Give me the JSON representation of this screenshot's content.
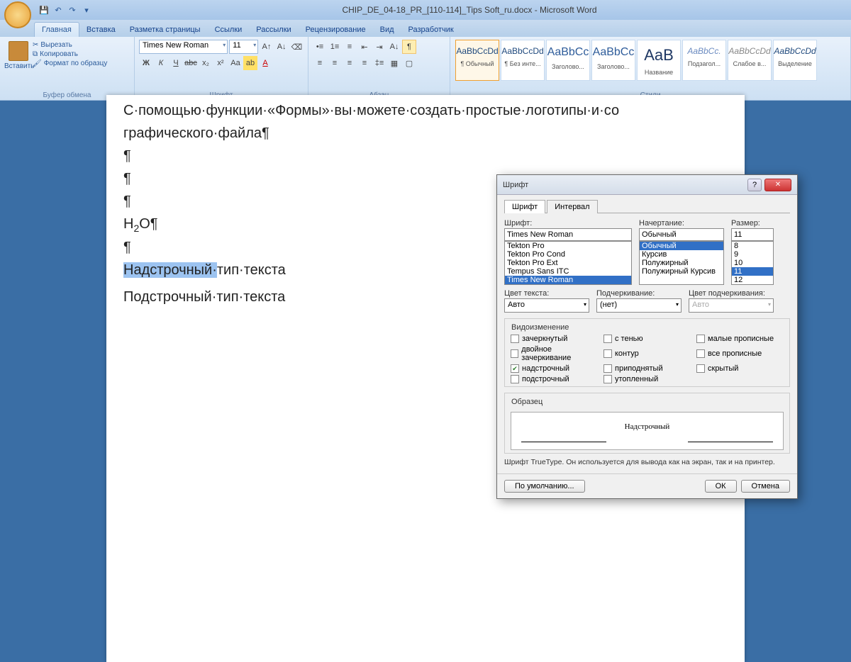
{
  "title": "CHIP_DE_04-18_PR_[110-114]_Tips Soft_ru.docx - Microsoft Word",
  "tabs": [
    "Главная",
    "Вставка",
    "Разметка страницы",
    "Ссылки",
    "Рассылки",
    "Рецензирование",
    "Вид",
    "Разработчик"
  ],
  "clipboard": {
    "paste": "Вставить",
    "cut": "Вырезать",
    "copy": "Копировать",
    "format": "Формат по образцу",
    "group": "Буфер обмена"
  },
  "font": {
    "name": "Times New Roman",
    "size": "11",
    "group": "Шрифт"
  },
  "para": {
    "group": "Абзац"
  },
  "styles": {
    "group": "Стили",
    "items": [
      {
        "preview": "AaBbCcDd",
        "name": "¶ Обычный",
        "sel": true
      },
      {
        "preview": "AaBbCcDd",
        "name": "¶ Без инте...",
        "sel": false
      },
      {
        "preview": "AaBbCc",
        "name": "Заголово...",
        "sel": false,
        "color": "#2e5c9a",
        "big": true
      },
      {
        "preview": "AaBbCc",
        "name": "Заголово...",
        "sel": false,
        "color": "#2e5c9a",
        "big": true
      },
      {
        "preview": "AaB",
        "name": "Название",
        "sel": false,
        "color": "#1f3864",
        "big": true,
        "bigger": true
      },
      {
        "preview": "AaBbCc.",
        "name": "Подзагол...",
        "sel": false,
        "color": "#6b8bc0",
        "italic": true
      },
      {
        "preview": "AaBbCcDd",
        "name": "Слабое в...",
        "sel": false,
        "color": "#888",
        "italic": true
      },
      {
        "preview": "AaBbCcDd",
        "name": "Выделение",
        "sel": false,
        "italic": true
      }
    ]
  },
  "doc": {
    "line1": "С·помощью·функции·«Формы»·вы·можете·создать·простые·логотипы·и·со",
    "line2": "графического·файла¶",
    "h2o_a": "H",
    "h2o_b": "2",
    "h2o_c": "O¶",
    "line3_sel": "Надстрочный·",
    "line3_rest": "тип·текста",
    "line4": "Подстрочный·тип·текста"
  },
  "dialog": {
    "title": "Шрифт",
    "tab_font": "Шрифт",
    "tab_spacing": "Интервал",
    "lbl_font": "Шрифт:",
    "lbl_style": "Начертание:",
    "lbl_size": "Размер:",
    "font_value": "Times New Roman",
    "font_list": [
      "Tekton Pro",
      "Tekton Pro Cond",
      "Tekton Pro Ext",
      "Tempus Sans ITC",
      "Times New Roman"
    ],
    "style_value": "Обычный",
    "style_list": [
      "Обычный",
      "Курсив",
      "Полужирный",
      "Полужирный Курсив"
    ],
    "size_value": "11",
    "size_list": [
      "8",
      "9",
      "10",
      "11",
      "12"
    ],
    "lbl_color": "Цвет текста:",
    "val_color": "Авто",
    "lbl_under": "Подчеркивание:",
    "val_under": "(нет)",
    "lbl_ucolor": "Цвет подчеркивания:",
    "val_ucolor": "Авто",
    "grp_effects": "Видоизменение",
    "chk": [
      {
        "l": "зачеркнутый",
        "c": false
      },
      {
        "l": "с тенью",
        "c": false
      },
      {
        "l": "малые прописные",
        "c": false
      },
      {
        "l": "двойное зачеркивание",
        "c": false
      },
      {
        "l": "контур",
        "c": false
      },
      {
        "l": "все прописные",
        "c": false
      },
      {
        "l": "надстрочный",
        "c": true
      },
      {
        "l": "приподнятый",
        "c": false
      },
      {
        "l": "скрытый",
        "c": false
      },
      {
        "l": "подстрочный",
        "c": false
      },
      {
        "l": "утопленный",
        "c": false
      }
    ],
    "grp_preview": "Образец",
    "preview_text": "Надстрочный",
    "hint": "Шрифт TrueType. Он используется для вывода как на экран, так и на принтер.",
    "btn_default": "По умолчанию...",
    "btn_ok": "ОК",
    "btn_cancel": "Отмена"
  }
}
